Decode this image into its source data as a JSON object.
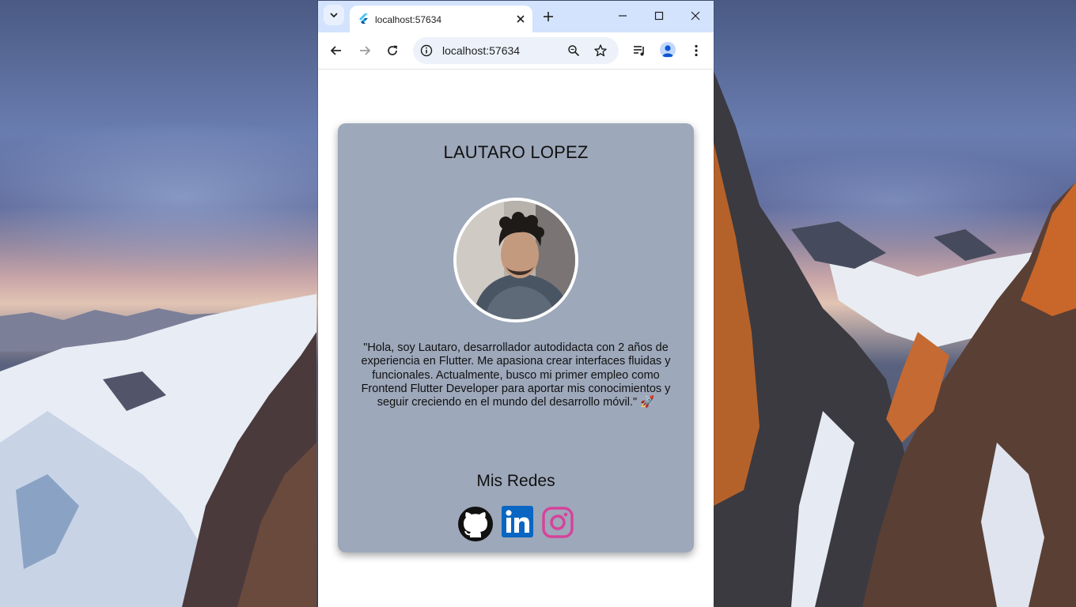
{
  "browser": {
    "tab_title": "localhost:57634",
    "url": "localhost:57634"
  },
  "profile": {
    "name": "LAUTARO LOPEZ",
    "bio": "\"Hola, soy Lautaro, desarrollador autodidacta con 2 años de experiencia en Flutter. Me apasiona crear interfaces fluidas y funcionales. Actualmente, busco mi primer empleo como Frontend Flutter Developer para aportar mis conocimientos y seguir creciendo en el mundo del desarrollo móvil.\" 🚀",
    "socials_heading": "Mis Redes",
    "socials": [
      {
        "icon": "github-icon"
      },
      {
        "icon": "linkedin-icon"
      },
      {
        "icon": "instagram-icon"
      }
    ]
  },
  "colors": {
    "card": "#9da8ba",
    "tabstrip": "#d3e3fd",
    "linkedin": "#0a66c2",
    "instagram": "#d6439a"
  }
}
